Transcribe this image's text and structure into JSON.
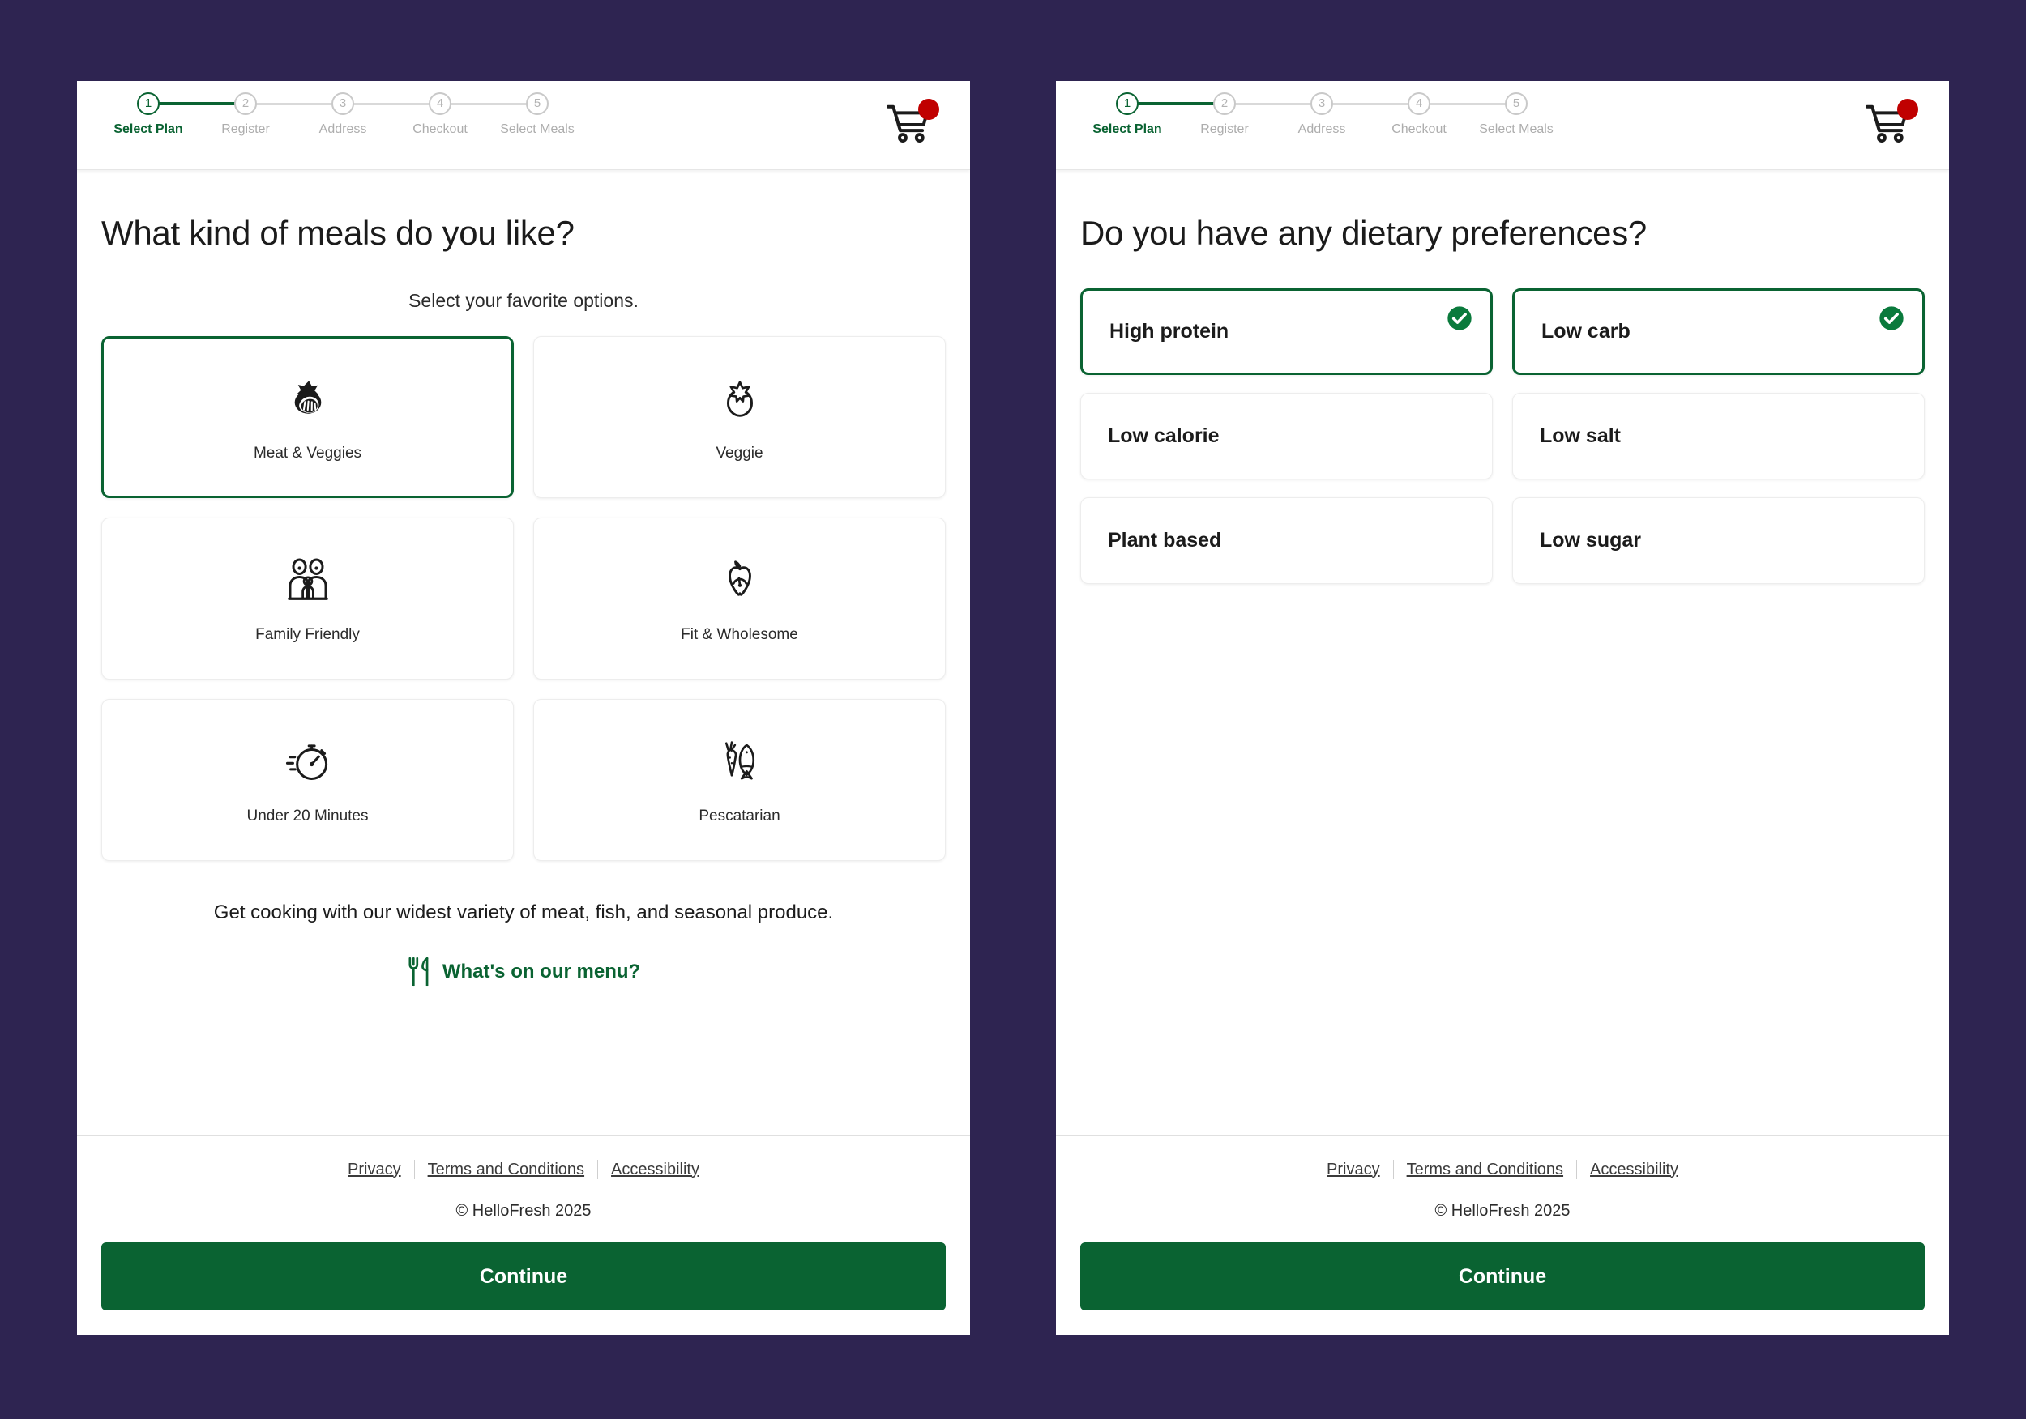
{
  "theme": {
    "background": "#2e2451",
    "brand_green": "#0a6332",
    "badge_red": "#c00000",
    "panel_background": "#ffffff"
  },
  "stepper": {
    "steps": [
      {
        "number": "1",
        "label": "Select Plan",
        "active": true
      },
      {
        "number": "2",
        "label": "Register",
        "active": false
      },
      {
        "number": "3",
        "label": "Address",
        "active": false
      },
      {
        "number": "4",
        "label": "Checkout",
        "active": false
      },
      {
        "number": "5",
        "label": "Select Meals",
        "active": false
      }
    ],
    "cart_icon": "shopping-cart-icon"
  },
  "left_panel": {
    "title": "What kind of meals do you like?",
    "subtitle": "Select your favorite options.",
    "options": [
      {
        "label": "Meat & Veggies",
        "icon": "meat-steak-icon",
        "selected": true
      },
      {
        "label": "Veggie",
        "icon": "tomato-icon",
        "selected": false
      },
      {
        "label": "Family Friendly",
        "icon": "family-people-icon",
        "selected": false
      },
      {
        "label": "Fit & Wholesome",
        "icon": "apple-gauge-icon",
        "selected": false
      },
      {
        "label": "Under 20 Minutes",
        "icon": "stopwatch-icon",
        "selected": false
      },
      {
        "label": "Pescatarian",
        "icon": "carrot-fish-icon",
        "selected": false
      }
    ],
    "blurb": "Get cooking with our widest variety of meat, fish, and seasonal produce.",
    "menu_link": "What's on our menu?",
    "menu_link_icon": "fork-knife-icon"
  },
  "right_panel": {
    "title": "Do you have any dietary preferences?",
    "preferences": [
      {
        "label": "High protein",
        "selected": true
      },
      {
        "label": "Low carb",
        "selected": true
      },
      {
        "label": "Low calorie",
        "selected": false
      },
      {
        "label": "Low salt",
        "selected": false
      },
      {
        "label": "Plant based",
        "selected": false
      },
      {
        "label": "Low sugar",
        "selected": false
      }
    ],
    "check_icon": "check-circle-icon"
  },
  "footer": {
    "links": [
      "Privacy",
      "Terms and Conditions",
      "Accessibility"
    ],
    "copyright": "© HelloFresh 2025",
    "continue_label": "Continue"
  }
}
